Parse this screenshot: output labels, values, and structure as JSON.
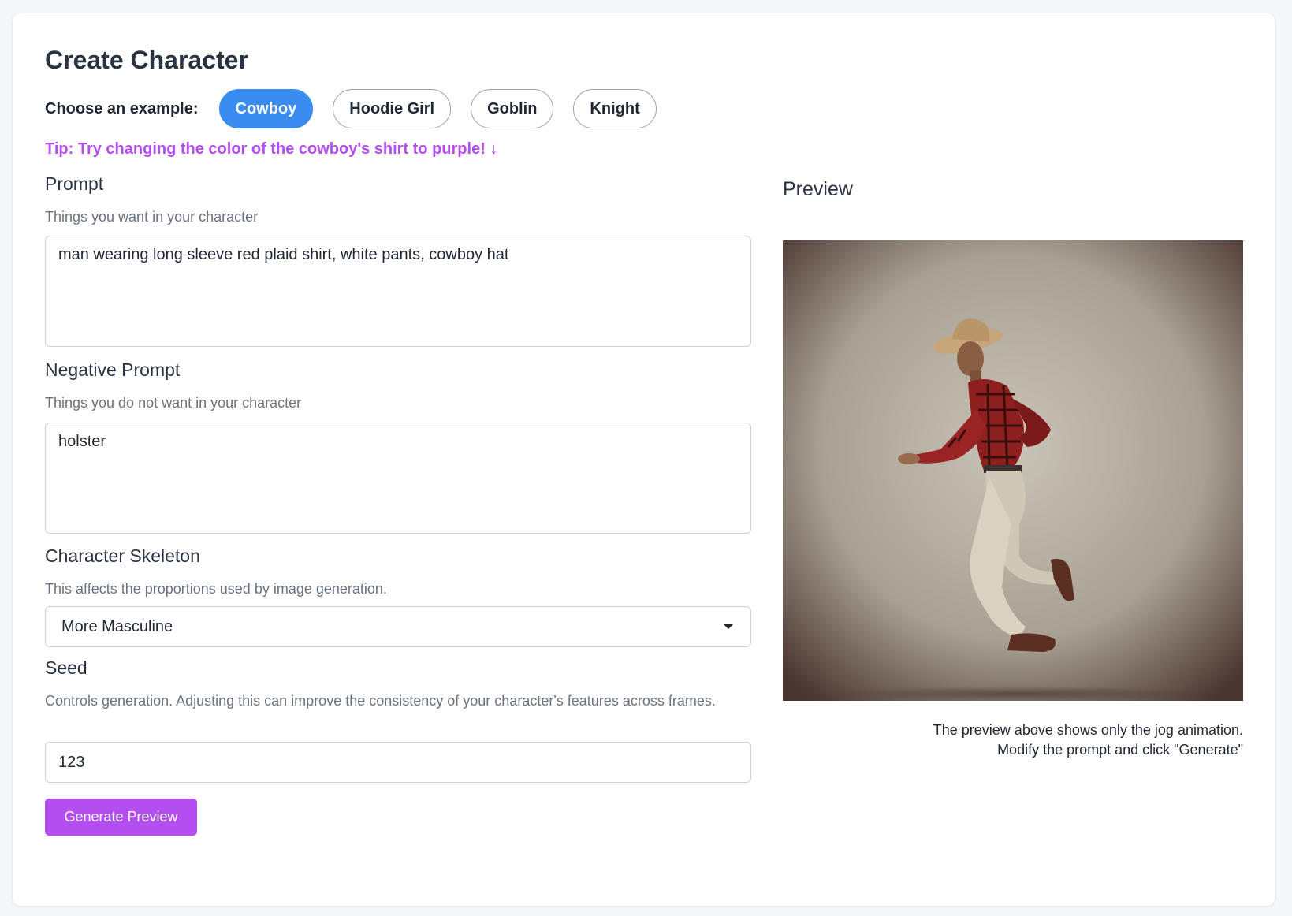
{
  "page": {
    "title": "Create Character"
  },
  "examples": {
    "label": "Choose an example:",
    "options": [
      "Cowboy",
      "Hoodie Girl",
      "Goblin",
      "Knight"
    ],
    "selected": "Cowboy"
  },
  "tip": "Tip: Try changing the color of the cowboy's shirt to purple! ↓",
  "prompt": {
    "label": "Prompt",
    "help": "Things you want in your character",
    "value": "man wearing long sleeve red plaid shirt, white pants, cowboy hat"
  },
  "negative_prompt": {
    "label": "Negative Prompt",
    "help": "Things you do not want in your character",
    "value": "holster"
  },
  "skeleton": {
    "label": "Character Skeleton",
    "help": "This affects the proportions used by image generation.",
    "value": "More Masculine"
  },
  "seed": {
    "label": "Seed",
    "help": "Controls generation. Adjusting this can improve the consistency of your character's features across frames.",
    "value": "123"
  },
  "generate_button": "Generate Preview",
  "preview": {
    "title": "Preview",
    "caption_line1": "The preview above shows only the jog animation.",
    "caption_line2": "Modify the prompt and click \"Generate\""
  },
  "colors": {
    "accent_blue": "#3b8cf0",
    "accent_purple": "#b44ef0",
    "text_dark": "#1f2733",
    "text_muted": "#6a7380"
  }
}
